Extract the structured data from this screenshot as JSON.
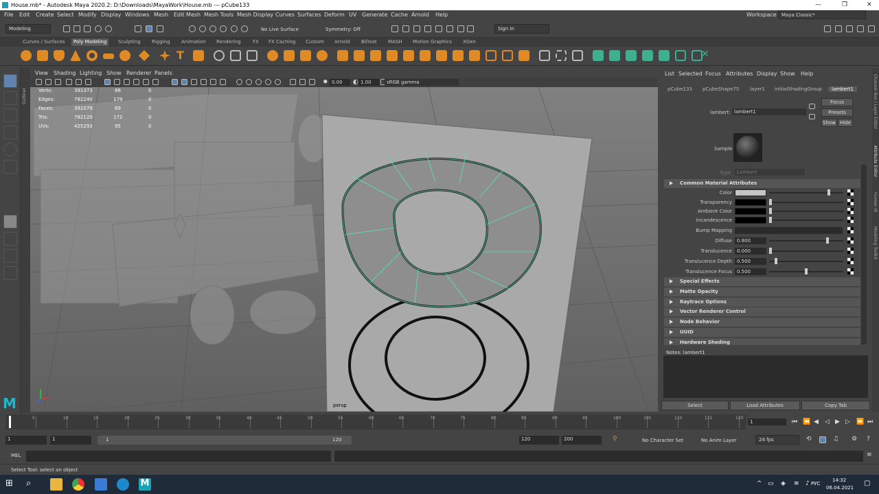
{
  "window": {
    "title": "House.mb* - Autodesk Maya 2020.2: D:\\Downloads\\MayaWork\\House.mb   ---   pCube133"
  },
  "menus": [
    "File",
    "Edit",
    "Create",
    "Select",
    "Modify",
    "Display",
    "Windows",
    "Mesh",
    "Edit Mesh",
    "Mesh Tools",
    "Mesh Display",
    "Curves",
    "Surfaces",
    "Deform",
    "UV",
    "Generate",
    "Cache",
    "Arnold",
    "Help"
  ],
  "workspace": {
    "label": "Workspace :",
    "value": "Maya Classic*"
  },
  "statusline": {
    "mode": "Modeling",
    "live_surface": "No Live Surface",
    "symmetry": "Symmetry: Off",
    "sign_in": "Sign In"
  },
  "shelf_tabs": [
    "Curves / Surfaces",
    "Poly Modeling",
    "Sculpting",
    "Rigging",
    "Animation",
    "Rendering",
    "FX",
    "FX Caching",
    "Custom",
    "Arnold",
    "Bifrost",
    "MASH",
    "Motion Graphics",
    "XGen"
  ],
  "shelf_active": "Poly Modeling",
  "panel_menus": [
    "View",
    "Shading",
    "Lighting",
    "Show",
    "Renderer",
    "Panels"
  ],
  "panel_toolbar": {
    "exposure": "0.00",
    "gamma": "1.00",
    "color_space": "sRGB gamma"
  },
  "hud": [
    {
      "label": "Verts:",
      "a": "391373",
      "b": "86",
      "c": "0"
    },
    {
      "label": "Edges:",
      "a": "782240",
      "b": "179",
      "c": "0"
    },
    {
      "label": "Faces:",
      "a": "391079",
      "b": "89",
      "c": "0"
    },
    {
      "label": "Tris:",
      "a": "782120",
      "b": "172",
      "c": "0"
    },
    {
      "label": "UVs:",
      "a": "425293",
      "b": "95",
      "c": "0"
    }
  ],
  "camera_label": "persp",
  "outliner_label": "Outliner",
  "attr": {
    "menus": [
      "List",
      "Selected",
      "Focus",
      "Attributes",
      "Display",
      "Show",
      "Help"
    ],
    "node_tabs": [
      "pCube133",
      "pCubeShape75",
      "layer1",
      "initialShadingGroup",
      "lambert1"
    ],
    "node_label": "lambert:",
    "node_name": "lambert1",
    "focus": "Focus",
    "presets": "Presets",
    "show": "Show",
    "hide": "Hide",
    "sample": "Sample",
    "type_label": "Type",
    "type_value": "Lambert",
    "common_section": "Common Material Attributes",
    "rows": [
      {
        "label": "Color",
        "value": "",
        "swatch": "#c4c4c4",
        "pos": 0.82
      },
      {
        "label": "Transparency",
        "value": "",
        "swatch": "#000000",
        "pos": 0.0
      },
      {
        "label": "Ambient Color",
        "value": "",
        "swatch": "#000000",
        "pos": 0.0
      },
      {
        "label": "Incandescence",
        "value": "",
        "swatch": "#000000",
        "pos": 0.0
      },
      {
        "label": "Bump Mapping",
        "value": "",
        "swatch": "",
        "pos": -1
      },
      {
        "label": "Diffuse",
        "value": "0.800",
        "swatch": "",
        "pos": 0.8
      },
      {
        "label": "Translucence",
        "value": "0.000",
        "swatch": "",
        "pos": 0.0
      },
      {
        "label": "Translucence Depth",
        "value": "0.500",
        "swatch": "",
        "pos": 0.08
      },
      {
        "label": "Translucence Focus",
        "value": "0.500",
        "swatch": "",
        "pos": 0.5
      }
    ],
    "sections": [
      "Special Effects",
      "Matte Opacity",
      "Raytrace Options",
      "Vector Renderer Control",
      "Node Behavior",
      "UUID",
      "Hardware Shading"
    ],
    "notes": "Notes:  lambert1",
    "bottom_buttons": [
      "Select",
      "Load Attributes",
      "Copy Tab"
    ]
  },
  "side_tabs": [
    "Channel Box / Layer Editor",
    "Attribute Editor",
    "Human IK",
    "Modeling Toolkit"
  ],
  "timeline": {
    "ticks": [
      "5",
      "10",
      "15",
      "20",
      "25",
      "30",
      "35",
      "40",
      "45",
      "50",
      "55",
      "60",
      "65",
      "70",
      "75",
      "80",
      "85",
      "90",
      "95",
      "100",
      "105",
      "110",
      "115",
      "120"
    ],
    "current": "1",
    "start_marker": "1"
  },
  "range": {
    "start": "1",
    "start2": "1",
    "slider_left": "1",
    "slider_right": "120",
    "end1": "120",
    "end2": "200",
    "char_set": "No Character Set",
    "anim_layer": "No Anim Layer",
    "fps": "24 fps"
  },
  "cmd": {
    "lang": "MEL"
  },
  "help_line": "Select Tool: select an object",
  "taskbar": {
    "lang": "РУС",
    "time": "14:32",
    "date": "06.04.2021"
  }
}
